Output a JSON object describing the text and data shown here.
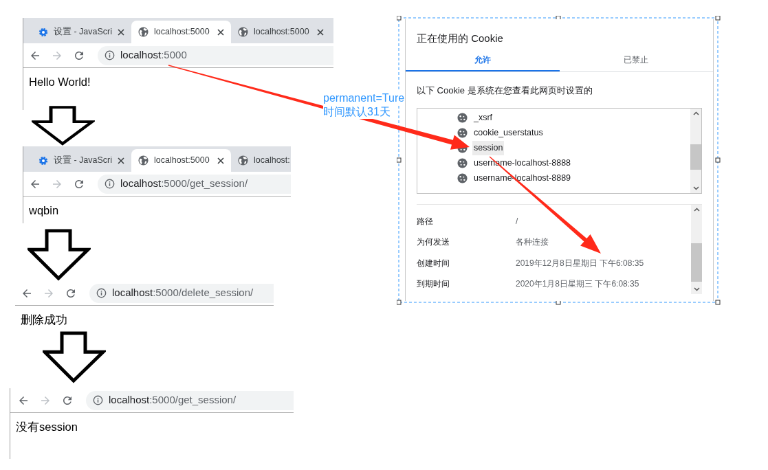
{
  "browser_snippets": [
    {
      "tabs": [
        {
          "label": "设置 - JavaScri",
          "selected": false
        },
        {
          "label": "localhost:5000",
          "selected": true
        },
        {
          "label": "localhost:5000",
          "selected": false
        }
      ],
      "url": {
        "host": "localhost",
        "rest": ":5000"
      },
      "page_text": "Hello World!"
    },
    {
      "tabs": [
        {
          "label": "设置 - JavaScri",
          "selected": false
        },
        {
          "label": "localhost:5000",
          "selected": true
        },
        {
          "label": "localhost:",
          "selected": false
        }
      ],
      "url": {
        "host": "localhost",
        "rest": ":5000/get_session/"
      },
      "page_text": "wqbin"
    },
    {
      "url": {
        "host": "localhost",
        "rest": ":5000/delete_session/"
      },
      "page_text": "删除成功"
    },
    {
      "url": {
        "host": "localhost",
        "rest": ":5000/get_session/"
      },
      "page_text": "没有session"
    }
  ],
  "annotation": [
    "permanent=Ture",
    "时间默认31天"
  ],
  "cookie_dialog": {
    "title": "正在使用的 Cookie",
    "tabs": [
      {
        "label": "允许",
        "selected": true
      },
      {
        "label": "已禁止",
        "selected": false
      }
    ],
    "description": "以下 Cookie 是系统在您查看此网页时设置的",
    "cookies": [
      {
        "name": "_xsrf",
        "selected": false
      },
      {
        "name": "cookie_userstatus",
        "selected": false
      },
      {
        "name": "session",
        "selected": true
      },
      {
        "name": "username-localhost-8888",
        "selected": false
      },
      {
        "name": "username-localhost-8889",
        "selected": false
      }
    ],
    "details": [
      {
        "label": "路径",
        "value": "/"
      },
      {
        "label": "为何发送",
        "value": "各种连接"
      },
      {
        "label": "创建时间",
        "value": "2019年12月8日星期日 下午6:08:35"
      },
      {
        "label": "到期时间",
        "value": "2020年1月8日星期三 下午6:08:35"
      }
    ]
  }
}
